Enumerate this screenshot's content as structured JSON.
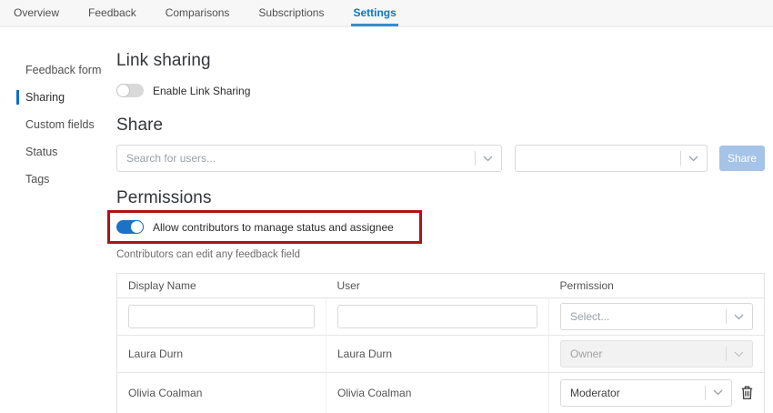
{
  "colors": {
    "accent_blue": "#0a77c8",
    "toggle_on_blue": "#1b72c7",
    "annotation_red": "#b01117",
    "share_button_blue": "#a6c3e8"
  },
  "tabs": [
    {
      "label": "Overview",
      "active": false
    },
    {
      "label": "Feedback",
      "active": false
    },
    {
      "label": "Comparisons",
      "active": false
    },
    {
      "label": "Subscriptions",
      "active": false
    },
    {
      "label": "Settings",
      "active": true
    }
  ],
  "sidebar": {
    "items": [
      {
        "label": "Feedback form",
        "active": false
      },
      {
        "label": "Sharing",
        "active": true
      },
      {
        "label": "Custom fields",
        "active": false
      },
      {
        "label": "Status",
        "active": false
      },
      {
        "label": "Tags",
        "active": false
      }
    ]
  },
  "link_sharing": {
    "title": "Link sharing",
    "toggle_label": "Enable Link Sharing",
    "toggle_state": "off"
  },
  "share": {
    "title": "Share",
    "user_search_placeholder": "Search for users...",
    "type_select_value": "",
    "button_label": "Share"
  },
  "permissions": {
    "title": "Permissions",
    "toggle_label": "Allow contributors to manage status and assignee",
    "toggle_state": "on",
    "note": "Contributors can edit any feedback field"
  },
  "table": {
    "columns": [
      "Display Name",
      "User",
      "Permission"
    ],
    "filter": {
      "display_name_value": "",
      "user_value": "",
      "permission_placeholder": "Select..."
    },
    "rows": [
      {
        "display_name": "Laura Durn",
        "user": "Laura Durn",
        "permission": "Owner",
        "permission_disabled": true,
        "removable": false
      },
      {
        "display_name": "Olivia Coalman",
        "user": "Olivia Coalman",
        "permission": "Moderator",
        "permission_disabled": false,
        "removable": true
      }
    ]
  }
}
